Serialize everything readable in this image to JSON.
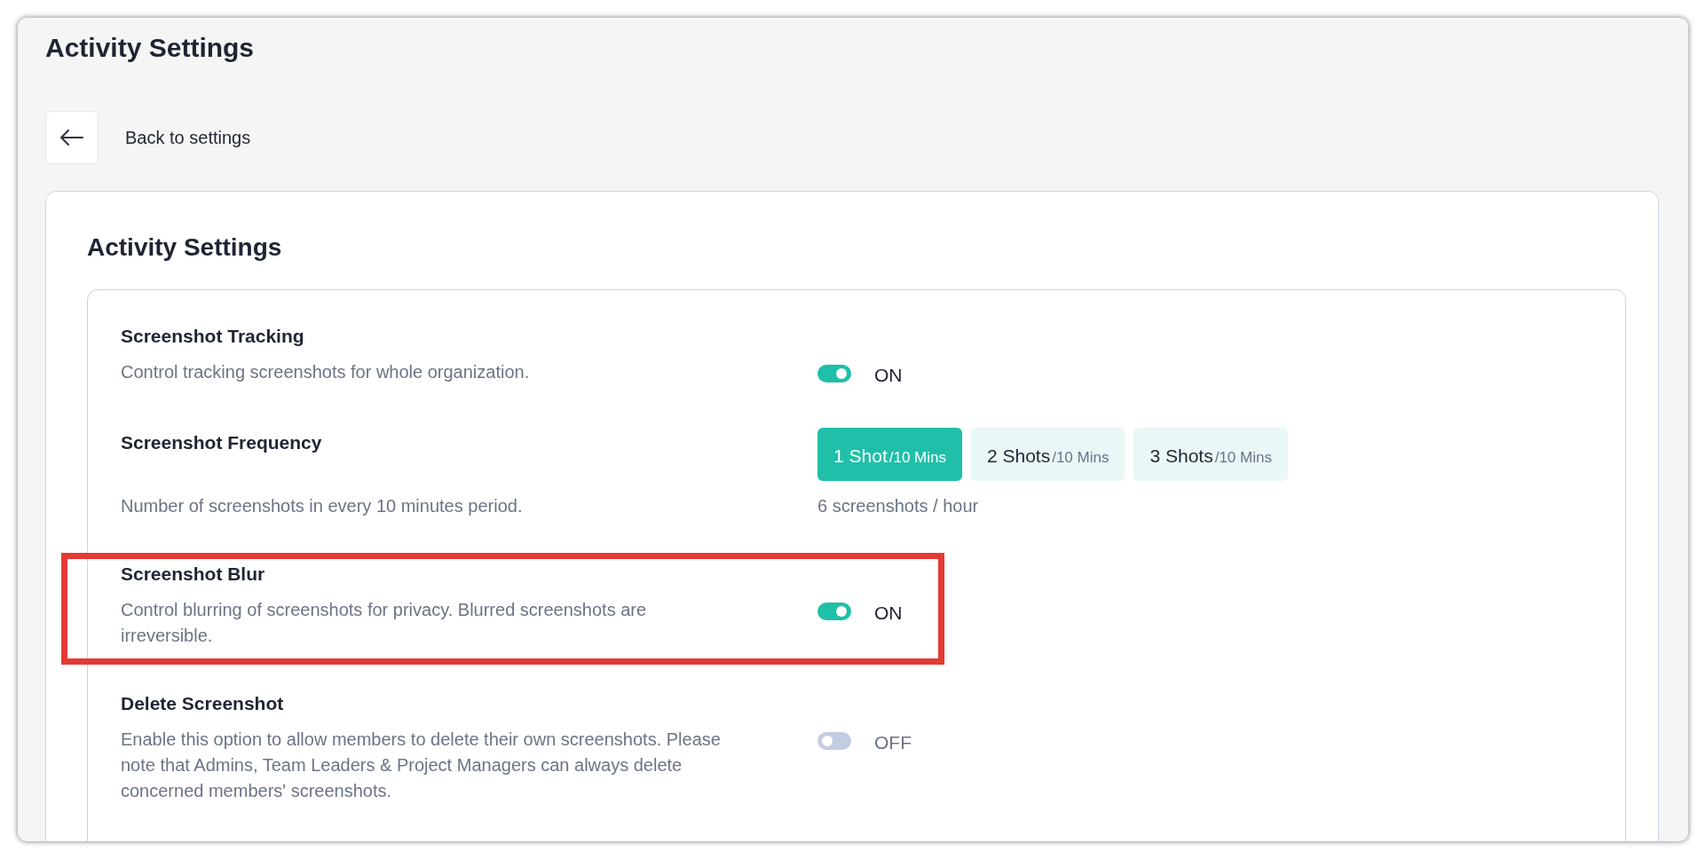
{
  "page_title": "Activity Settings",
  "back": {
    "label": "Back to settings"
  },
  "card": {
    "title": "Activity Settings",
    "settings": [
      {
        "kind": "toggle",
        "title": "Screenshot Tracking",
        "description": "Control tracking screenshots for whole organization.",
        "on": true,
        "state_label": "ON",
        "highlighted": false
      },
      {
        "kind": "choice",
        "title": "Screenshot Frequency",
        "description": "Number of screenshots in every 10 minutes period.",
        "options": [
          {
            "count": "1 Shot",
            "unit": "/10 Mins",
            "selected": true
          },
          {
            "count": "2 Shots",
            "unit": "/10 Mins",
            "selected": false
          },
          {
            "count": "3 Shots",
            "unit": "/10 Mins",
            "selected": false
          }
        ],
        "caption": "6 screenshots / hour",
        "highlighted": false
      },
      {
        "kind": "toggle",
        "title": "Screenshot Blur",
        "description": "Control blurring of screenshots for privacy. Blurred screenshots are irreversible.",
        "on": true,
        "state_label": "ON",
        "highlighted": true
      },
      {
        "kind": "toggle",
        "title": "Delete Screenshot",
        "description": "Enable this option to allow members to delete their own screenshots. Please note that Admins, Team Leaders & Project Managers can always delete concerned members' screenshots.",
        "on": false,
        "state_label": "OFF",
        "highlighted": false
      }
    ]
  }
}
